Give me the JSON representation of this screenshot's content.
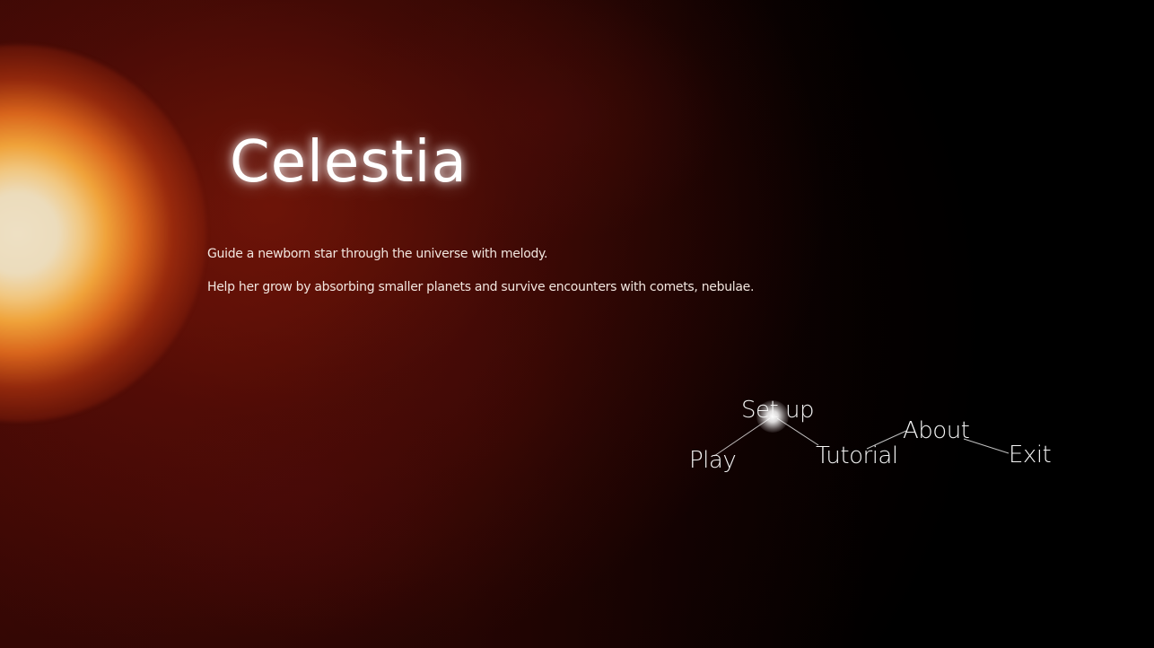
{
  "game": {
    "title": "Celestia",
    "description": [
      "Guide a newborn star through the universe with melody.",
      "Help her grow by absorbing smaller planets and survive encounters with comets, nebulae."
    ]
  },
  "menu": {
    "selected": "Set up",
    "items": [
      {
        "id": "play",
        "label": "Play"
      },
      {
        "id": "setup",
        "label": "Set up"
      },
      {
        "id": "tutorial",
        "label": "Tutorial"
      },
      {
        "id": "about",
        "label": "About"
      },
      {
        "id": "exit",
        "label": "Exit"
      }
    ]
  },
  "colors": {
    "background": "#000000",
    "sun_core": "#eee0c4",
    "sun_corona": "#f0a33a",
    "nebula": "#3a0805",
    "text": "#ffffff"
  }
}
